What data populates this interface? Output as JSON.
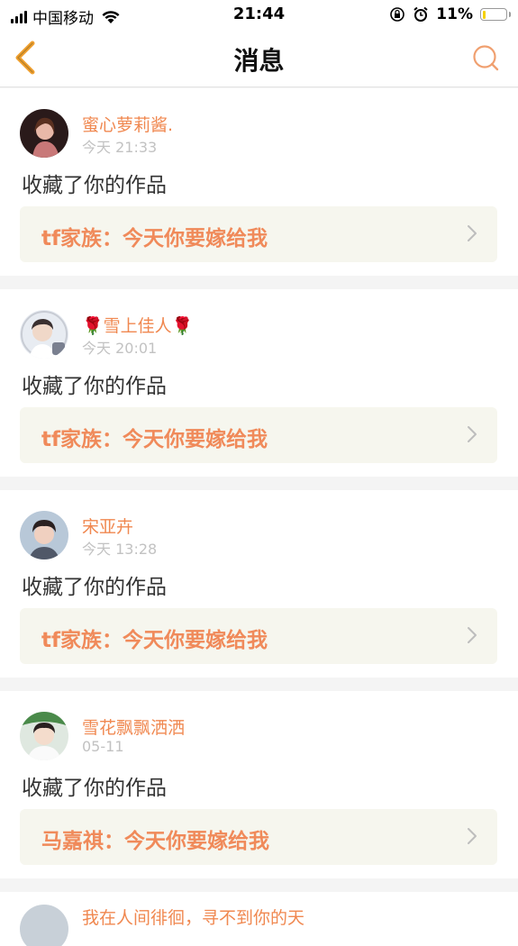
{
  "status_bar": {
    "carrier": "中国移动",
    "time": "21:44",
    "battery_percent": "11%",
    "battery_level": 0.11,
    "icons": [
      "signal-icon",
      "wifi-icon",
      "orientation-lock-icon",
      "alarm-icon",
      "battery-icon"
    ]
  },
  "nav": {
    "title": "消息",
    "back_icon": "chevron-left-icon",
    "search_icon": "search-icon",
    "accent_color": "#f0a030"
  },
  "messages": [
    {
      "user": "蜜心萝莉酱.",
      "time": "今天 21:33",
      "action": "收藏了你的作品",
      "work": "tf家族：今天你要嫁给我"
    },
    {
      "user": "🌹雪上佳人🌹",
      "time": "今天 20:01",
      "action": "收藏了你的作品",
      "work": "tf家族：今天你要嫁给我"
    },
    {
      "user": "宋亚卉",
      "time": "今天 13:28",
      "action": "收藏了你的作品",
      "work": "tf家族：今天你要嫁给我"
    },
    {
      "user": "雪花飘飘洒洒",
      "time": "05-11",
      "action": "收藏了你的作品",
      "work": "马嘉祺：今天你要嫁给我"
    }
  ],
  "partial_message": {
    "user": "我在人间徘徊，寻不到你的天"
  },
  "colors": {
    "username": "#f08850",
    "work_title": "#f08a5a",
    "work_bg": "#f6f6ee",
    "time": "#c2c2c2"
  }
}
